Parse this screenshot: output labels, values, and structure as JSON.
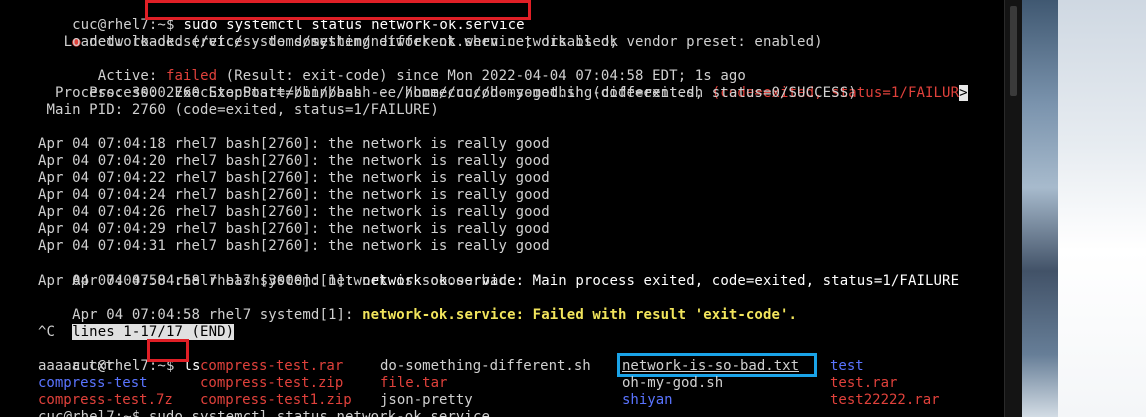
{
  "terminal": {
    "prompt1": "cuc@rhel7:~$",
    "cmd1": "sudo systemctl status network-ok.service",
    "unit_bullet": "●",
    "unit_line": "network-ok.service - do something different when network is ok",
    "loaded": "   Loaded: loaded (/etc/systemd/system/network-ok.service; disabled; vendor preset: enabled)",
    "active_label": "   Active: ",
    "active_state": "failed",
    "active_rest": " (Result: exit-code) since Mon 2022-04-04 07:04:58 EDT; 1s ago",
    "process1_a": "  Process: 2760 ExecStart=/bin/bash -e /home/cuc/do-something-different.sh ",
    "process1_b": "(code=exited, status=1/FAILUR",
    "trunc_marker": ">",
    "process2": "  Process: 3000 ExecStopPost=/bin/bash -e /home/cuc/oh-my-god.sh (code=exited, status=0/SUCCESS)",
    "mainpid": " Main PID: 2760 (code=exited, status=1/FAILURE)",
    "log": [
      "Apr 04 07:04:18 rhel7 bash[2760]: the network is really good",
      "Apr 04 07:04:20 rhel7 bash[2760]: the network is really good",
      "Apr 04 07:04:22 rhel7 bash[2760]: the network is really good",
      "Apr 04 07:04:24 rhel7 bash[2760]: the network is really good",
      "Apr 04 07:04:26 rhel7 bash[2760]: the network is really good",
      "Apr 04 07:04:29 rhel7 bash[2760]: the network is really good",
      "Apr 04 07:04:31 rhel7 bash[2760]: the network is really good"
    ],
    "log_exit_prefix": "Apr 04 07:04:58 rhel7 systemd[1]: ",
    "log_exit_msg": "network-ok.service: Main process exited, code=exited, status=1/FAILURE",
    "log_bad": "Apr 04 07:04:58 rhel7 bash[3000]: network is sooooo bad",
    "log_fail_prefix": "Apr 04 07:04:58 rhel7 systemd[1]: ",
    "log_fail_msg": "network-ok.service: Failed with result 'exit-code'.",
    "pager_status": "lines 1-17/17 (END)",
    "ctrl_c": "^C",
    "prompt2": "cuc@rhel7:~$",
    "cmd2": "ls",
    "ls_files": {
      "col1": [
        "aaaaa.txt",
        "compress-test",
        "compress-test.7z"
      ],
      "col2": [
        "compress-test.rar",
        "compress-test.zip",
        "compress-test1.zip"
      ],
      "col3": [
        "do-something-different.sh",
        "file.tar",
        "json-pretty"
      ],
      "col4": [
        "network-is-so-bad.txt",
        "oh-my-god.sh",
        "shiyan"
      ],
      "col5": [
        "test",
        "test.rar",
        "test22222.rar"
      ]
    },
    "last_line": "cuc@rhel7:~$ sudo systemctl status network-ok.service"
  },
  "colors": {
    "annotation_red": "#e01f26",
    "annotation_blue": "#1aa3e8",
    "failed_red": "#e0413b",
    "dir_blue": "#5a74ff",
    "highlight_yellow": "#f2e55c"
  }
}
